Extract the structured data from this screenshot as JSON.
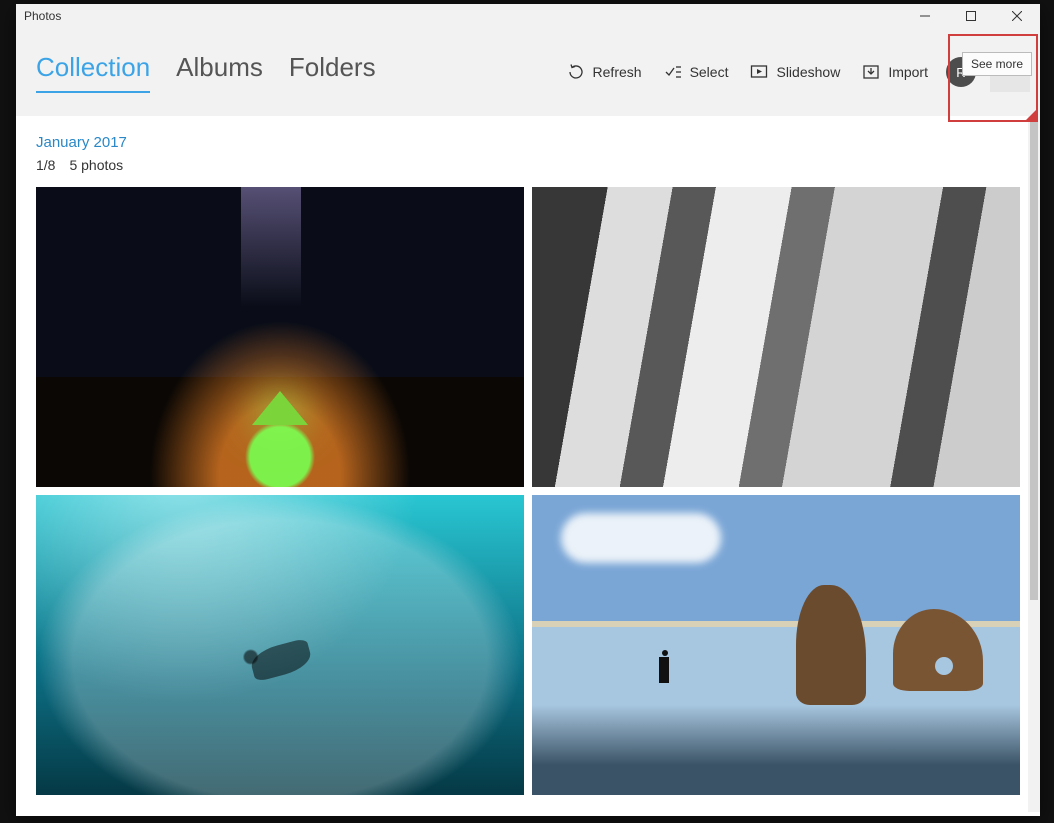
{
  "window": {
    "title": "Photos"
  },
  "winControls": {
    "minimize": "—",
    "maximize": "□",
    "close": "✕"
  },
  "tabs": [
    {
      "label": "Collection",
      "active": true
    },
    {
      "label": "Albums",
      "active": false
    },
    {
      "label": "Folders",
      "active": false
    }
  ],
  "actions": {
    "refresh": "Refresh",
    "select": "Select",
    "slideshow": "Slideshow",
    "import": "Import"
  },
  "avatar": {
    "initial": "R"
  },
  "more": {
    "glyph": "···",
    "tooltip": "See more"
  },
  "section": {
    "title": "January 2017",
    "page": "1/8",
    "count": "5 photos"
  },
  "photos": [
    {
      "name": "milky-way-tent"
    },
    {
      "name": "rock-face-climber"
    },
    {
      "name": "underwater-swimmer"
    },
    {
      "name": "beach-runner-rocks"
    }
  ]
}
